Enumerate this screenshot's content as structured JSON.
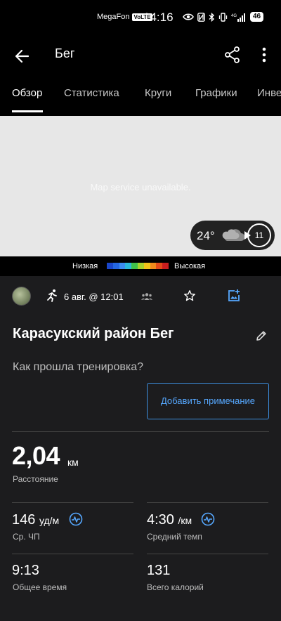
{
  "status_bar": {
    "carrier": "MegaFon",
    "volte": "VoLTE",
    "time": "14:16",
    "network": "4G",
    "battery": "46"
  },
  "app_bar": {
    "title": "Бег",
    "icons": [
      "back-arrow-icon",
      "share-icon",
      "more-vert-icon"
    ]
  },
  "tabs": [
    {
      "label": "Обзор",
      "active": true
    },
    {
      "label": "Статистика",
      "active": false
    },
    {
      "label": "Круги",
      "active": false
    },
    {
      "label": "Графики",
      "active": false
    },
    {
      "label": "Инве",
      "active": false
    }
  ],
  "map": {
    "message": "Map service unavailable.",
    "weather": {
      "temperature": "24°",
      "icon": "cloud-icon",
      "wind": "11"
    },
    "legend": {
      "low": "Низкая",
      "high": "Высокая",
      "colors": [
        "#1a46c8",
        "#2466e0",
        "#3b8cf0",
        "#2bb8d8",
        "#3fc24a",
        "#a6d22c",
        "#f0c419",
        "#f08a1c",
        "#e24a1a",
        "#c81e1e"
      ]
    }
  },
  "activity": {
    "date": "6 авг. @ 12:01",
    "title": "Карасукский район Бег",
    "question": "Как прошла тренировка?",
    "add_note_label": "Добавить примечание"
  },
  "stats": {
    "distance": {
      "value": "2,04",
      "unit": "км",
      "label": "Расстояние"
    },
    "avg_hr": {
      "value": "146",
      "unit": "уд/м",
      "label": "Ср. ЧП"
    },
    "avg_pace": {
      "value": "4:30",
      "unit": "/км",
      "label": "Средний темп"
    },
    "total_time": {
      "value": "9:13",
      "label": "Общее время"
    },
    "calories": {
      "value": "131",
      "label": "Всего калорий"
    }
  },
  "colors": {
    "accent": "#56a8ff",
    "background": "#1c1c1e"
  }
}
